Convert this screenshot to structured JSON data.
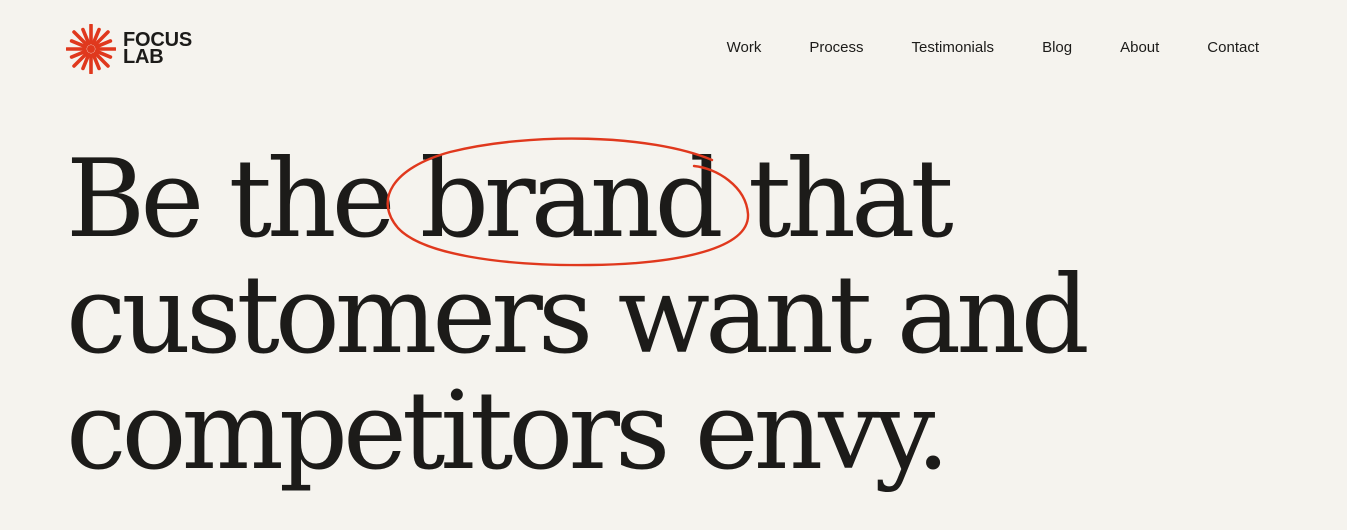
{
  "brand": {
    "name_line1": "FOCUS",
    "name_line2": "LAB",
    "logo_icon": "starburst-icon",
    "accent_color": "#e0381d"
  },
  "nav": {
    "items": [
      {
        "label": "Work"
      },
      {
        "label": "Process"
      },
      {
        "label": "Testimonials"
      },
      {
        "label": "Blog"
      },
      {
        "label": "About"
      },
      {
        "label": "Contact"
      }
    ]
  },
  "hero": {
    "line1_before": "Be the ",
    "line1_circled": "brand",
    "line1_after": " that",
    "line2": "customers want and",
    "line3": "competitors envy."
  },
  "colors": {
    "background": "#f5f3ee",
    "text": "#1c1b19",
    "accent": "#e0381d"
  }
}
